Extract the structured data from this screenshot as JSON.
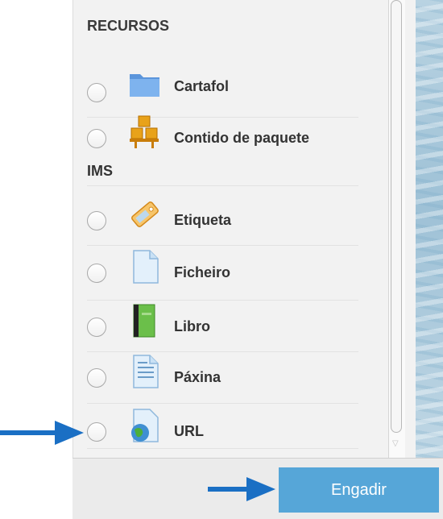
{
  "section": {
    "heading": "RECURSOS"
  },
  "items": [
    {
      "label": "Cartafol",
      "icon": "folder-icon"
    },
    {
      "label": "Contido de paquete",
      "label_line2": "IMS",
      "icon": "ims-package-icon"
    },
    {
      "label": "Etiqueta",
      "icon": "label-tag-icon"
    },
    {
      "label": "Ficheiro",
      "icon": "file-icon"
    },
    {
      "label": "Libro",
      "icon": "book-icon"
    },
    {
      "label": "Páxina",
      "icon": "page-icon"
    },
    {
      "label": "URL",
      "icon": "url-globe-icon"
    }
  ],
  "footer": {
    "add_label": "Engadir"
  },
  "colors": {
    "accent": "#56a6d8",
    "arrow": "#1a6fc4"
  }
}
